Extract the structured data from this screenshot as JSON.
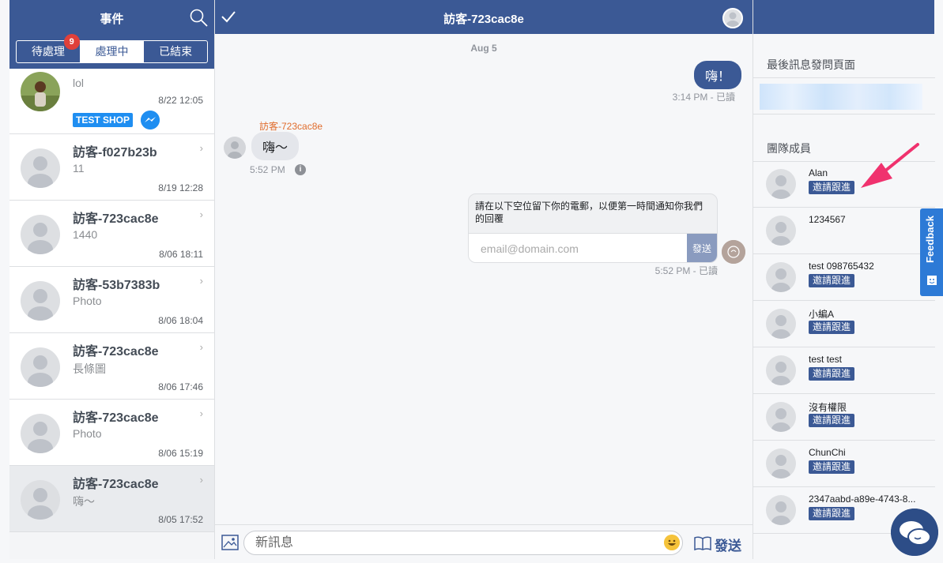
{
  "left": {
    "title": "事件",
    "tabs": [
      {
        "label": "待處理",
        "badge": "9"
      },
      {
        "label": "處理中"
      },
      {
        "label": "已結束"
      }
    ],
    "conversations": [
      {
        "preview": "lol",
        "time": "8/22 12:05",
        "tag": "TEST SHOP"
      },
      {
        "name": "訪客-f027b23b",
        "preview": "11",
        "time": "8/19 12:28"
      },
      {
        "name": "訪客-723cac8e",
        "preview": "1440",
        "time": "8/06 18:11"
      },
      {
        "name": "訪客-53b7383b",
        "preview": "Photo",
        "time": "8/06 18:04"
      },
      {
        "name": "訪客-723cac8e",
        "preview": "長條圖",
        "time": "8/06 17:46"
      },
      {
        "name": "訪客-723cac8e",
        "preview": "Photo",
        "time": "8/06 15:19"
      },
      {
        "name": "訪客-723cac8e",
        "preview": "嗨～",
        "time": "8/05 17:52"
      }
    ]
  },
  "chat": {
    "title": "訪客-723cac8e",
    "date_separator": "Aug 5",
    "msg_out_1": "嗨！",
    "msg_out_1_meta": "3:14 PM - 已讀",
    "sender_name": "訪客-723cac8e",
    "msg_in_1": "嗨～",
    "msg_in_1_meta": "5:52 PM",
    "info_icon_glyph": "i",
    "form_text": "請在以下空位留下你的電郵，以便第一時間通知你我們的回覆",
    "form_placeholder": "email@domain.com",
    "form_send": "發送",
    "msg_out_2_meta": "5:52 PM - 已讀",
    "composer_placeholder": "新訊息",
    "send_label": "發送"
  },
  "right": {
    "last_page_title": "最後訊息發問頁面",
    "team_title": "團隊成員",
    "members": [
      {
        "name": "Alan",
        "button": "邀請跟進"
      },
      {
        "name": "1234567"
      },
      {
        "name": "test 098765432",
        "button": "邀請跟進"
      },
      {
        "name": "小編A",
        "button": "邀請跟進"
      },
      {
        "name": "test test",
        "button": "邀請跟進"
      },
      {
        "name": "沒有權限",
        "button": "邀請跟進"
      },
      {
        "name": "ChunChi",
        "button": "邀請跟進"
      },
      {
        "name": "2347aabd-a89e-4743-8...",
        "button": "邀請跟進"
      }
    ]
  },
  "feedback": {
    "label": "Feedback"
  },
  "colors": {
    "header": "#3b5995",
    "badge": "#e0403a",
    "tag": "#1f8ef1",
    "arrow": "#f0326e",
    "feedback": "#2d7ad6"
  },
  "icons": [
    "search-icon",
    "check-icon",
    "image-icon",
    "emoji-icon",
    "book-icon",
    "messenger-icon",
    "chevron-right-icon",
    "info-icon",
    "chat-bubble-icon",
    "arrow-annotation-icon"
  ]
}
